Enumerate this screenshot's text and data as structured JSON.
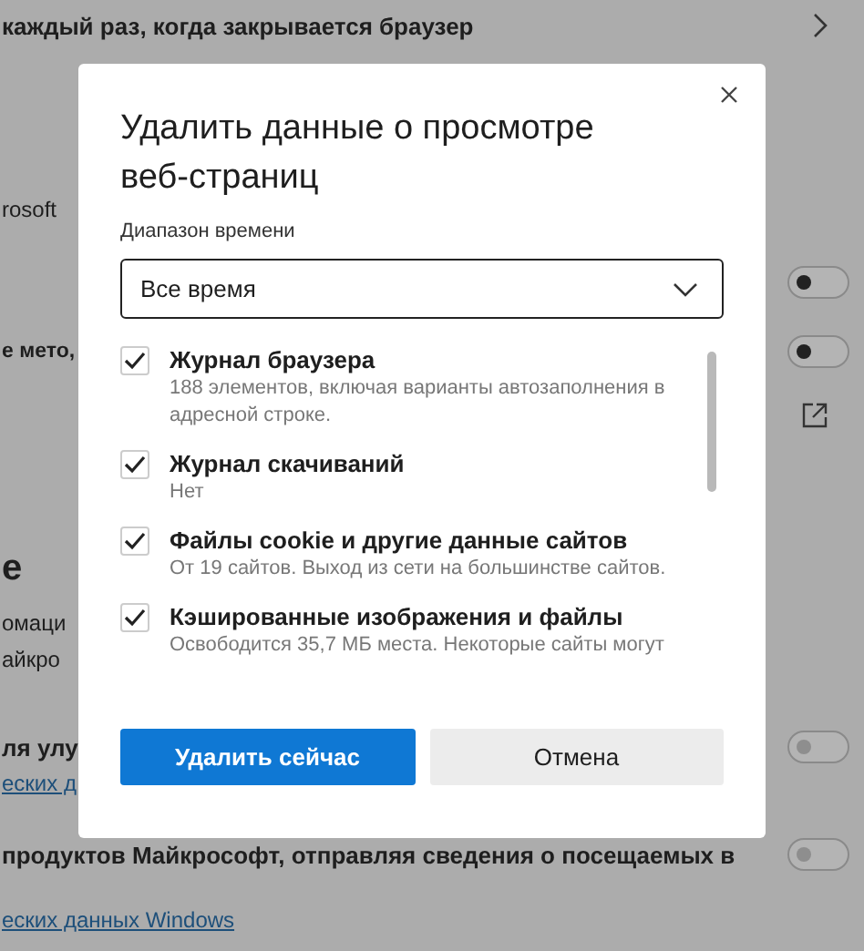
{
  "page": {
    "rows": [
      {
        "kind": "text",
        "text": "каждый раз, когда закрывается браузер",
        "control": {
          "kind": "chevron"
        }
      },
      {
        "kind": "text",
        "text": "rosoft"
      },
      {
        "control": {
          "kind": "toggle",
          "on": false
        }
      },
      {
        "kind": "text",
        "text": "е мето,",
        "control": {
          "kind": "toggle",
          "on": false
        }
      },
      {
        "control": {
          "kind": "external"
        }
      },
      {
        "kind": "heading",
        "text": "е"
      },
      {
        "kind": "text",
        "text": "омаци"
      },
      {
        "kind": "text",
        "text": "айкро"
      },
      {
        "kind": "text",
        "text": "ля улу",
        "control": {
          "kind": "toggle",
          "on": false
        }
      },
      {
        "kind": "link",
        "text": "еских д"
      },
      {
        "kind": "text",
        "text": "продуктов Майкрософт, отправляя сведения о посещаемых в",
        "control": {
          "kind": "toggle",
          "on": false
        }
      },
      {
        "kind": "link",
        "text": "еских данных Windows"
      }
    ]
  },
  "dialog": {
    "title": "Удалить данные о просмотре веб-страниц",
    "time_range": {
      "label": "Диапазон времени",
      "value": "Все время"
    },
    "items": [
      {
        "label": "Журнал браузера",
        "description": "188 элементов, включая варианты автозаполнения в адресной строке.",
        "checked": true
      },
      {
        "label": "Журнал скачиваний",
        "description": "Нет",
        "checked": true
      },
      {
        "label": "Файлы cookie и другие данные сайтов",
        "description": "От 19 сайтов. Выход из сети на большинстве сайтов.",
        "checked": true
      },
      {
        "label": "Кэшированные изображения и файлы",
        "description": "Освободится 35,7 МБ места. Некоторые сайты могут",
        "checked": true
      }
    ],
    "buttons": [
      {
        "label": "Удалить сейчас",
        "kind": "primary"
      },
      {
        "label": "Отмена",
        "kind": "secondary"
      }
    ]
  }
}
